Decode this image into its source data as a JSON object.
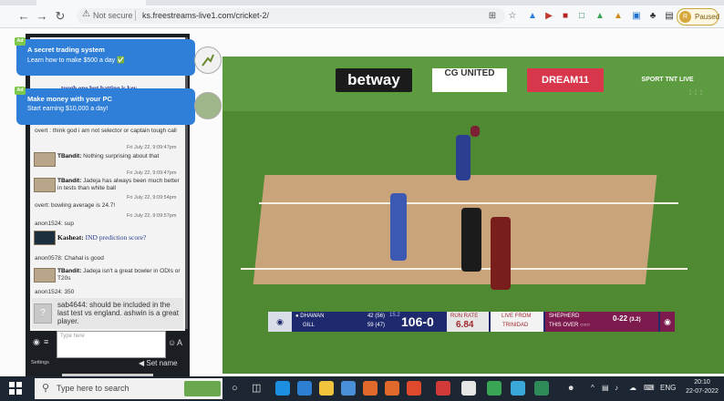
{
  "browser": {
    "not_secure": "Not secure",
    "url": "ks.freestreams-live1.com/cricket-2/",
    "paused": "Paused",
    "avatar_letter": "R"
  },
  "ads": [
    {
      "badge": "Ad",
      "title": "A secret trading system",
      "subtitle": "Learn how to make $500 a day ✅"
    },
    {
      "badge": "Ad",
      "title": "Make money with your PC",
      "subtitle": "Start earning $10,000 a day!"
    }
  ],
  "chat": {
    "hidden_line": "tough one but batting is key",
    "messages": [
      {
        "text": "overt : think god i am not selector or captain tough call",
        "time": ""
      },
      {
        "user": "TBandit:",
        "text": "Nothing surprising about that",
        "time": "Fri July 22, 9:09:47pm"
      },
      {
        "user": "TBandit:",
        "text": "Jadeja has always been much better in tests than white ball",
        "time": "Fri July 22, 9:09:47pm"
      },
      {
        "text": "overt: bowling average is 24.7!",
        "time": "Fri July 22, 9:09:54pm"
      },
      {
        "text": "anon1524: sup",
        "time": "Fri July 22, 9:09:57pm"
      },
      {
        "user": "Kasheat:",
        "text": "IND prediction score?",
        "time": ""
      },
      {
        "text": "anon0578: Chahal is good",
        "time": ""
      },
      {
        "user": "TBandit:",
        "text": "Jadeja isn't a great bowler in ODIs or T20s",
        "time": ""
      },
      {
        "text": "anon1524: 350",
        "time": ""
      },
      {
        "text": "sab4644: should be included in the last test vs england. ashwin is a great player.",
        "time": ""
      }
    ],
    "input_placeholder": "Type here",
    "settings_label": "Settings",
    "set_name": "Set name"
  },
  "video": {
    "sponsors": [
      "betway",
      "CG UNITED",
      "DREAM11",
      "SPORT TNT LIVE"
    ],
    "scoreboard": {
      "batter1": "DHAWAN",
      "batter1_score": "42",
      "batter1_balls": "(56)",
      "batter2": "GILL",
      "batter2_score": "59",
      "batter2_balls": "(47)",
      "overs": "15.2",
      "total": "106-0",
      "run_rate_label": "RUN RATE",
      "run_rate": "6.84",
      "live_from_label": "LIVE FROM",
      "venue": "TRINIDAD",
      "bowler": "SHEPHERD",
      "bowler_figures": "0-22",
      "bowler_overs": "(3.2)",
      "this_over_label": "THIS OVER"
    }
  },
  "taskbar": {
    "search_placeholder": "Type here to search",
    "language": "ENG",
    "time": "20:10",
    "date": "22-07-2022"
  }
}
